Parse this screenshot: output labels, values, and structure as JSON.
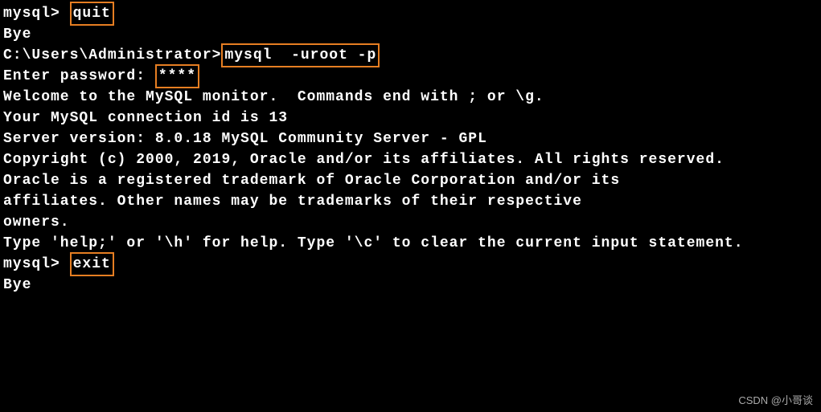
{
  "terminal": {
    "line1_prompt": "mysql> ",
    "line1_cmd": "quit",
    "line2": "Bye",
    "line3": "",
    "line4_prompt": "C:\\Users\\Administrator>",
    "line4_cmd": "mysql  -uroot -p",
    "line5_label": "Enter password: ",
    "line5_pw": "****",
    "line6": "Welcome to the MySQL monitor.  Commands end with ; or \\g.",
    "line7": "Your MySQL connection id is 13",
    "line8": "Server version: 8.0.18 MySQL Community Server - GPL",
    "line9": "",
    "line10": "Copyright (c) 2000, 2019, Oracle and/or its affiliates. All rights reserved.",
    "line11": "",
    "line12": "Oracle is a registered trademark of Oracle Corporation and/or its",
    "line13": "affiliates. Other names may be trademarks of their respective",
    "line14": "owners.",
    "line15": "",
    "line16": "Type 'help;' or '\\h' for help. Type '\\c' to clear the current input statement.",
    "line17": "",
    "line18_prompt": "mysql> ",
    "line18_cmd": "exit",
    "line19": "Bye"
  },
  "watermark": "CSDN @小哥谈"
}
